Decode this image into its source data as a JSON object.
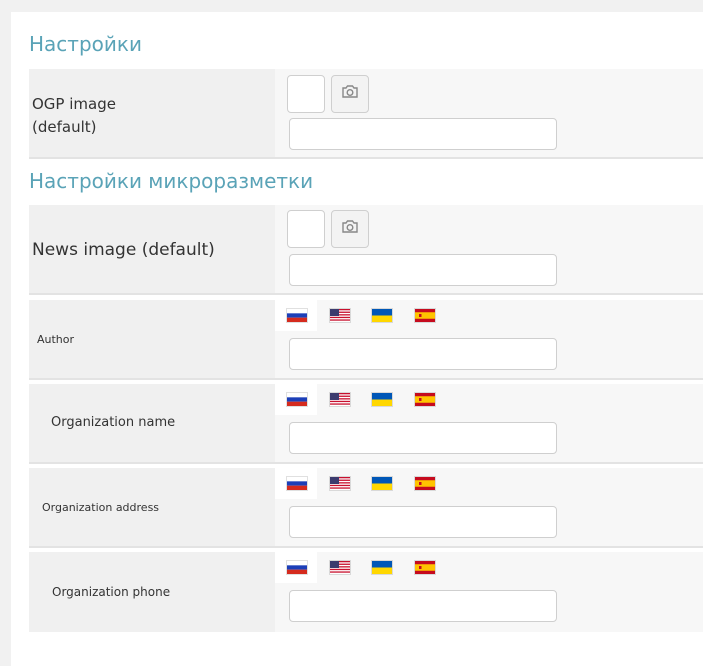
{
  "sections": {
    "settings_title": "Настройки",
    "markup_title": "Настройки микроразметки"
  },
  "fields": {
    "ogp_image": {
      "label_line1": "OGP image",
      "label_line2": "(default)"
    },
    "news_image": {
      "label": "News image (default)"
    },
    "author": {
      "label": "Author"
    },
    "org_name": {
      "label": "Organization name"
    },
    "org_address": {
      "label": "Organization address"
    },
    "org_phone": {
      "label": "Organization phone"
    }
  },
  "languages": [
    "ru",
    "en",
    "uk",
    "es"
  ],
  "flag_icons": [
    "flag-ru-icon",
    "flag-us-icon",
    "flag-ua-icon",
    "flag-es-icon"
  ],
  "colors": {
    "accent": "#5aa3b7",
    "label_bg": "#f0f0f0",
    "value_bg": "#f7f7f7"
  }
}
